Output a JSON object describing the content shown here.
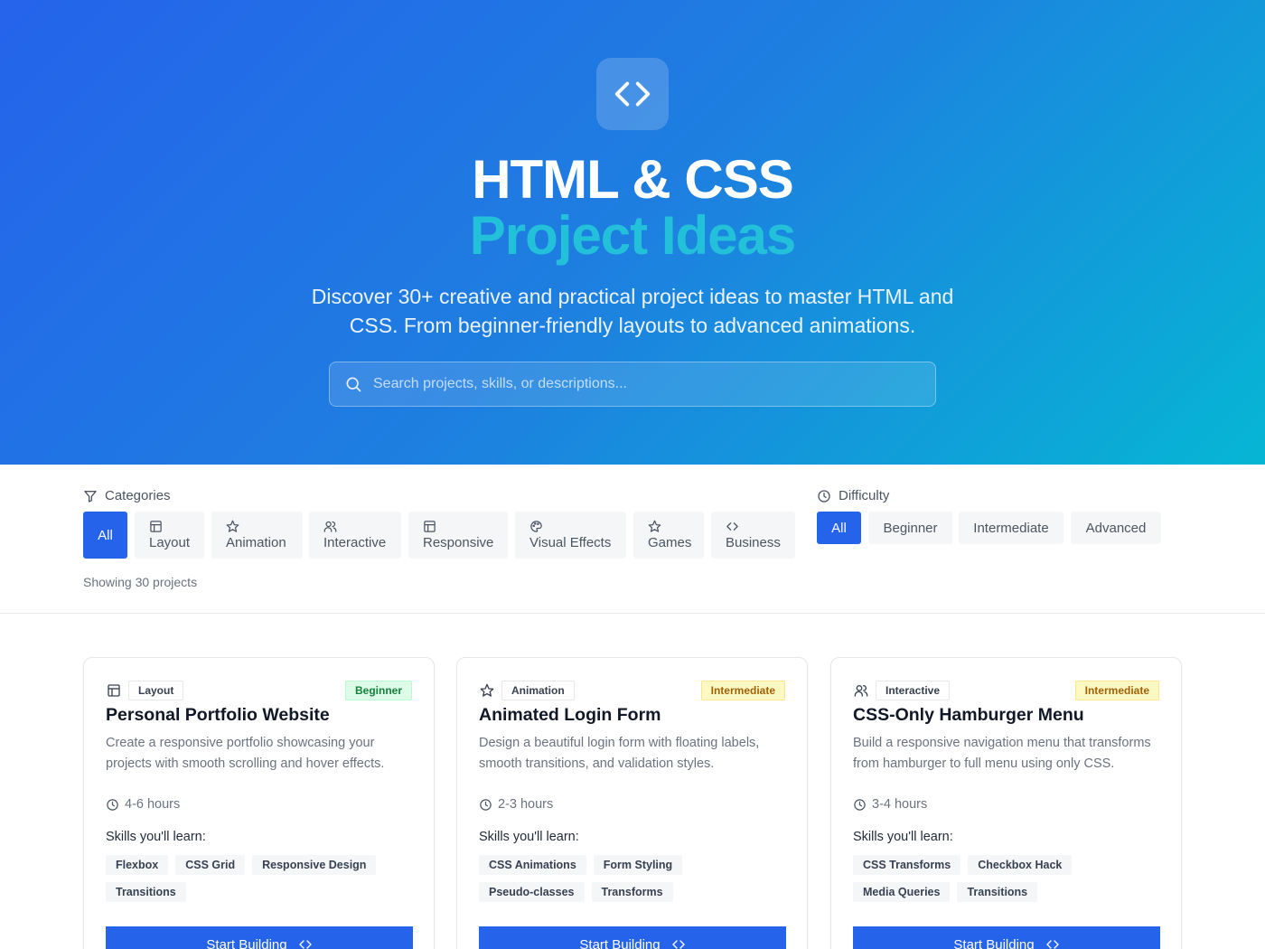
{
  "hero": {
    "title_line1": "HTML & CSS",
    "title_line2": "Project Ideas",
    "subtitle": "Discover 30+ creative and practical project ideas to master HTML and CSS. From beginner-friendly layouts to advanced animations.",
    "search_placeholder": "Search projects, skills, or descriptions...",
    "search_value": ""
  },
  "filters": {
    "categories_label": "Categories",
    "categories": [
      {
        "label": "All",
        "icon": "",
        "active": true
      },
      {
        "label": "Layout",
        "icon": "layout-icon",
        "active": false
      },
      {
        "label": "Animation",
        "icon": "star-icon",
        "active": false
      },
      {
        "label": "Interactive",
        "icon": "users-icon",
        "active": false
      },
      {
        "label": "Responsive",
        "icon": "layout-icon",
        "active": false
      },
      {
        "label": "Visual Effects",
        "icon": "palette-icon",
        "active": false
      },
      {
        "label": "Games",
        "icon": "star-icon",
        "active": false
      },
      {
        "label": "Business",
        "icon": "code-icon",
        "active": false
      }
    ],
    "difficulty_label": "Difficulty",
    "difficulties": [
      {
        "label": "All",
        "active": true
      },
      {
        "label": "Beginner",
        "active": false
      },
      {
        "label": "Intermediate",
        "active": false
      },
      {
        "label": "Advanced",
        "active": false
      }
    ],
    "showing_text": "Showing 30 projects"
  },
  "cards": [
    {
      "category": "Layout",
      "category_icon": "layout-icon",
      "difficulty": "Beginner",
      "title": "Personal Portfolio Website",
      "description": "Create a responsive portfolio showcasing your projects with smooth scrolling and hover effects.",
      "time": "4-6 hours",
      "skills_heading": "Skills you'll learn:",
      "skills": [
        "Flexbox",
        "CSS Grid",
        "Responsive Design",
        "Transitions"
      ],
      "cta": "Start Building"
    },
    {
      "category": "Animation",
      "category_icon": "star-icon",
      "difficulty": "Intermediate",
      "title": "Animated Login Form",
      "description": "Design a beautiful login form with floating labels, smooth transitions, and validation styles.",
      "time": "2-3 hours",
      "skills_heading": "Skills you'll learn:",
      "skills": [
        "CSS Animations",
        "Form Styling",
        "Pseudo-classes",
        "Transforms"
      ],
      "cta": "Start Building"
    },
    {
      "category": "Interactive",
      "category_icon": "users-icon",
      "difficulty": "Intermediate",
      "title": "CSS-Only Hamburger Menu",
      "description": "Build a responsive navigation menu that transforms from hamburger to full menu using only CSS.",
      "time": "3-4 hours",
      "skills_heading": "Skills you'll learn:",
      "skills": [
        "CSS Transforms",
        "Checkbox Hack",
        "Media Queries",
        "Transitions"
      ],
      "cta": "Start Building"
    }
  ],
  "colors": {
    "primary": "#2563eb",
    "hero_gradient_start": "#2563eb",
    "hero_gradient_end": "#06b6d4",
    "accent_cyan": "#22c1d9",
    "beginner_bg": "#dcfce7",
    "intermediate_bg": "#fef9c3"
  }
}
